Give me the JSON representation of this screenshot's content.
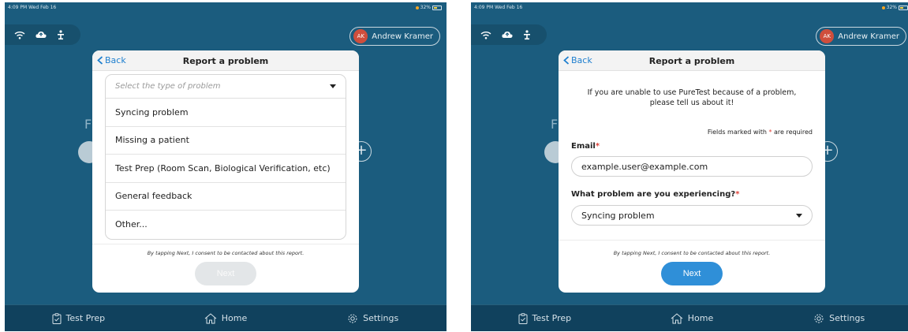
{
  "status": {
    "time": "4:09 PM  Wed Feb 16",
    "battery": "32%"
  },
  "user": {
    "initials": "AK",
    "name": "Andrew Kramer"
  },
  "background": {
    "letter": "F",
    "plus": "+"
  },
  "tabs": [
    {
      "label": "Test Prep",
      "icon": "clipboard-check-icon"
    },
    {
      "label": "Home",
      "icon": "home-icon"
    },
    {
      "label": "Settings",
      "icon": "gear-icon"
    }
  ],
  "modal": {
    "back_label": "Back",
    "title": "Report a problem",
    "consent": "By tapping Next, I consent to be contacted about this report.",
    "next_label": "Next"
  },
  "left": {
    "dropdown_placeholder": "Select the type of problem",
    "options": [
      "Syncing problem",
      "Missing a patient",
      "Test Prep (Room Scan, Biological Verification, etc)",
      "General feedback",
      "Other..."
    ],
    "next_state": "disabled"
  },
  "right": {
    "intro": "If you are unable to use PureTest because of a problem, please tell us about it!",
    "required_note_prefix": "Fields marked with",
    "required_note_star": "*",
    "required_note_suffix": "are required",
    "email_label": "Email",
    "email_value": "example.user@example.com",
    "problem_label": "What problem are you experiencing?",
    "problem_value": "Syncing problem",
    "next_state": "enabled"
  },
  "colors": {
    "background": "#1b5c7e",
    "tabbar": "#10415d",
    "accent_blue": "#2f8fd8",
    "disabled_button": "#e3e6e8",
    "home_indicator": "#d9a636",
    "required_star": "#e0433a"
  }
}
